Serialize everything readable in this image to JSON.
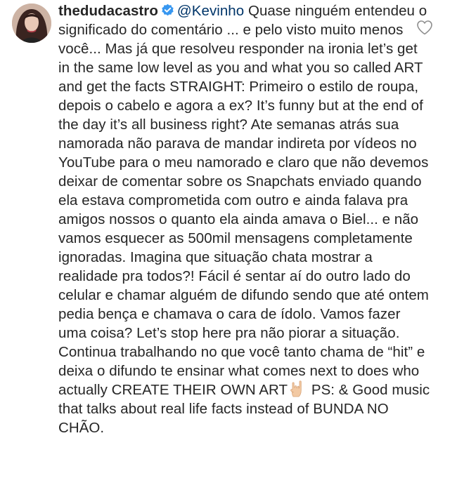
{
  "comment": {
    "username": "thedudacastro",
    "verified": true,
    "mention": "@Kevinho",
    "text_before_emoji": " Quase ninguém entendeu o significado do comentário ... e pelo visto muito menos você... Mas já que resolveu responder na ironia let’s get in the same low level as you and what you so called ART and get the facts STRAIGHT: Primeiro o estilo de roupa, depois o cabelo e agora a ex? It’s funny but at the end of the day it’s all business right? Ate semanas atrás sua namorada não parava de mandar indireta por vídeos no YouTube para o meu namorado e claro que não devemos deixar de comentar sobre os Snapchats enviado quando ela estava comprometida com outro e ainda falava pra amigos nossos o quanto ela ainda amava o Biel... e não vamos esquecer as 500mil mensagens completamente ignoradas. Imagina que situação chata mostrar a realidade pra todos?! Fácil é sentar aí do outro lado do celular e chamar alguém de difundo sendo que até ontem pedia bença e chamava o cara de ídolo. Vamos fazer uma coisa? Let’s stop here pra não piorar a situação. Continua trabalhando no que você tanto chama de “hit”  e deixa o difundo te ensinar what comes next to does who actually CREATE THEIR OWN ART",
    "emoji": "rock-on-hand-icon",
    "text_after_emoji": " PS: & Good music that talks about real life facts instead of BUNDA NO CHÃO."
  },
  "icons": {
    "verified_badge": "verified-badge-icon",
    "like": "heart-outline-icon"
  },
  "colors": {
    "text": "#262626",
    "mention": "#003569",
    "verified": "#3897f0",
    "like_outline": "#8e8e8e"
  }
}
